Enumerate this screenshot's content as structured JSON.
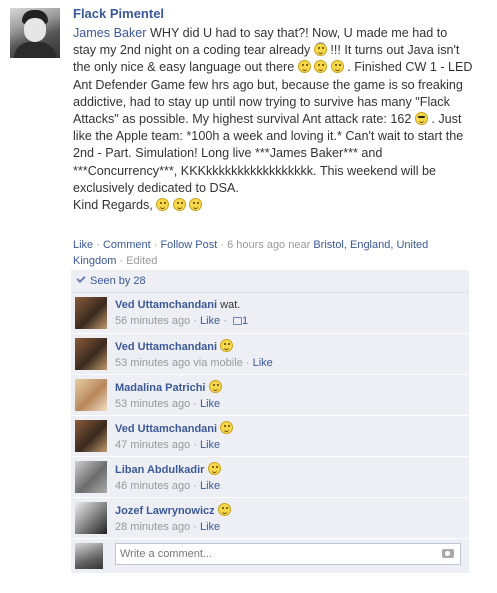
{
  "post": {
    "author": "Flack Pimentel",
    "mention": "James Baker",
    "lines": [
      " WHY did U had to say that?! Now, U made me had to stay my 2nd night on a coding tear already ",
      " !!! It turns out Java isn't the only nice & easy language out there ",
      " . Finished CW 1 - LED Ant Defender Game few hrs ago but, because the game is so freaking addictive, had to stay up until now trying to survive has many \"Flack Attacks\" as possible. My highest survival Ant attack rate: 162 ",
      " . Just like the Apple team: *100h a week and loving it.* Can't wait to start the 2nd - Part. Simulation! Long live ***James Baker*** and ***Concurrency***, KKKkkkkkkkkkkkkkkkkk. This weekend will be exclusively dedicated to DSA."
    ],
    "signoff": "Kind Regards,"
  },
  "meta": {
    "like": "Like",
    "comment": "Comment",
    "follow": "Follow Post",
    "sep": " · ",
    "time": "6 hours ago near",
    "location": "Bristol, England, United Kingdom",
    "edited": "Edited"
  },
  "seen_by": "Seen by 28",
  "comments": [
    {
      "name": "Ved Uttamchandani",
      "text": "wat.",
      "time": "56 minutes ago",
      "via": "",
      "like": "Like",
      "likes": "1"
    },
    {
      "name": "Ved Uttamchandani",
      "text": "",
      "time": "53 minutes ago via mobile",
      "via": "",
      "like": "Like",
      "likes": ""
    },
    {
      "name": "Madalina Patrichi",
      "text": "",
      "time": "53 minutes ago",
      "via": "",
      "like": "Like",
      "likes": ""
    },
    {
      "name": "Ved Uttamchandani",
      "text": "",
      "time": "47 minutes ago",
      "via": "",
      "like": "Like",
      "likes": ""
    },
    {
      "name": "Liban Abdulkadir",
      "text": "",
      "time": "46 minutes ago",
      "via": "",
      "like": "Like",
      "likes": ""
    },
    {
      "name": "Jozef Lawrynowicz",
      "text": "",
      "time": "28 minutes ago",
      "via": "",
      "like": "Like",
      "likes": ""
    }
  ],
  "write_comment": {
    "placeholder": "Write a comment..."
  },
  "colors": {
    "link": "#3b5998",
    "feedback_bg": "#edeff4",
    "meta_gray": "#999999"
  }
}
